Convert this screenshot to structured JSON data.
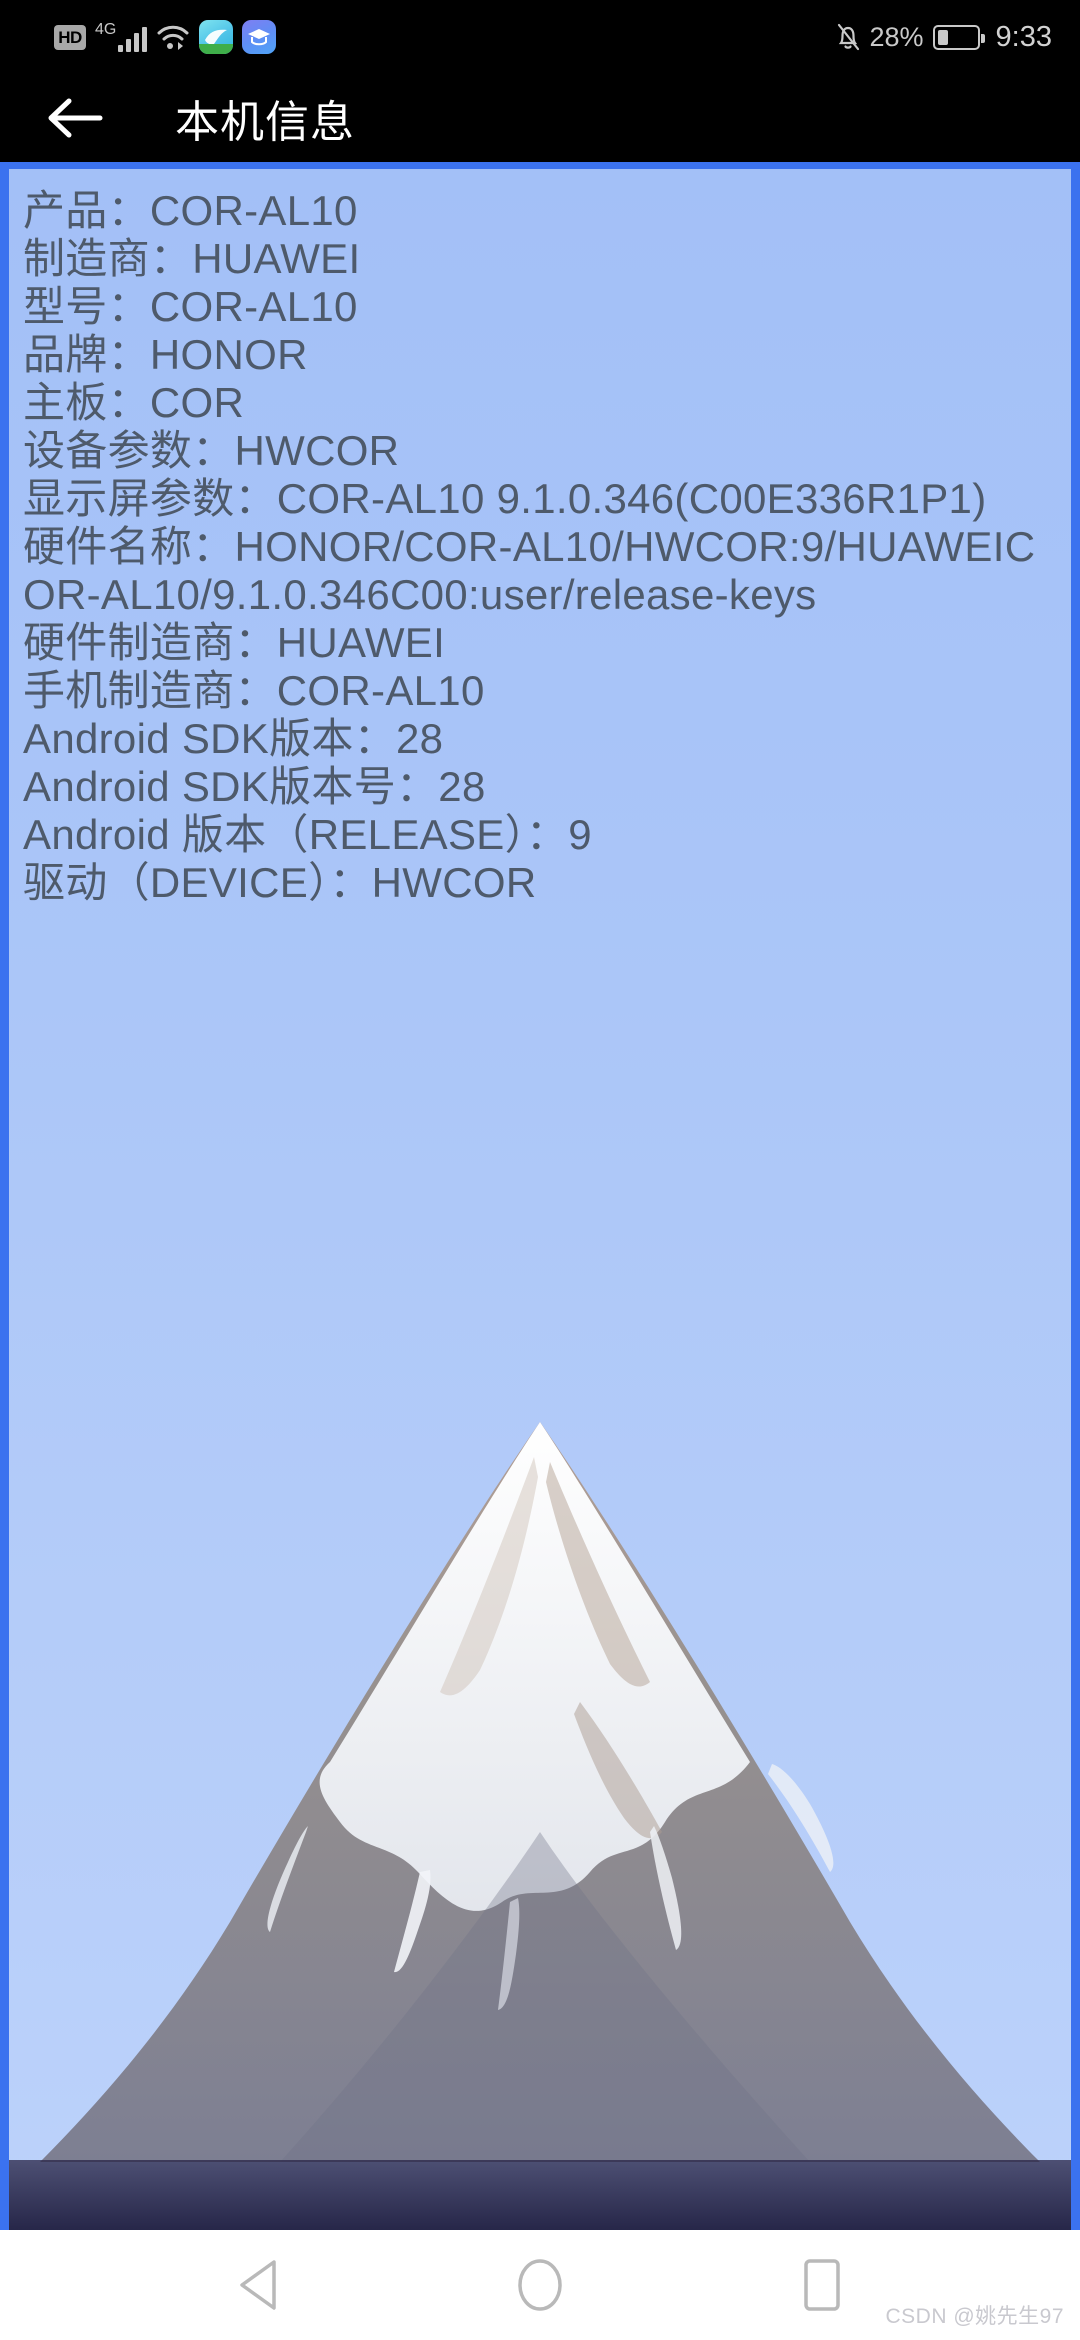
{
  "status_bar": {
    "hd_label": "HD",
    "network_label": "4G",
    "icons": [
      "hd-icon",
      "signal-bars-icon",
      "wifi-icon",
      "app-tickets-icon",
      "app-education-icon",
      "notifications-muted-icon",
      "battery-icon"
    ],
    "battery_percent": "28%",
    "battery_level": 28,
    "time": "9:33"
  },
  "app_bar": {
    "back_icon": "arrow-left-icon",
    "title": "本机信息"
  },
  "device_info": {
    "lines": [
      "产品：COR-AL10",
      "制造商：HUAWEI",
      "型号：COR-AL10",
      "品牌：HONOR",
      "主板：COR",
      "设备参数：HWCOR",
      "显示屏参数：COR-AL10 9.1.0.346(C00E336R1P1)",
      "硬件名称：HONOR/COR-AL10/HWCOR:9/HUAWEICOR-AL10/9.1.0.346C00:user/release-keys",
      "硬件制造商：HUAWEI",
      "手机制造商：COR-AL10",
      "Android SDK版本：28",
      "Android SDK版本号：28",
      "Android 版本（RELEASE）：9",
      "驱动（DEVICE）：HWCOR"
    ]
  },
  "nav_bar": {
    "back_label": "back-triangle-icon",
    "home_label": "home-circle-icon",
    "recents_label": "recents-square-icon"
  },
  "watermark": {
    "text": "CSDN @姚先生97"
  },
  "colors": {
    "accent_border": "#3b72ef",
    "content_bg": "#a8c4f8",
    "text": "#4e5a6b",
    "status_bg": "#000000",
    "nav_bg": "#ffffff"
  }
}
